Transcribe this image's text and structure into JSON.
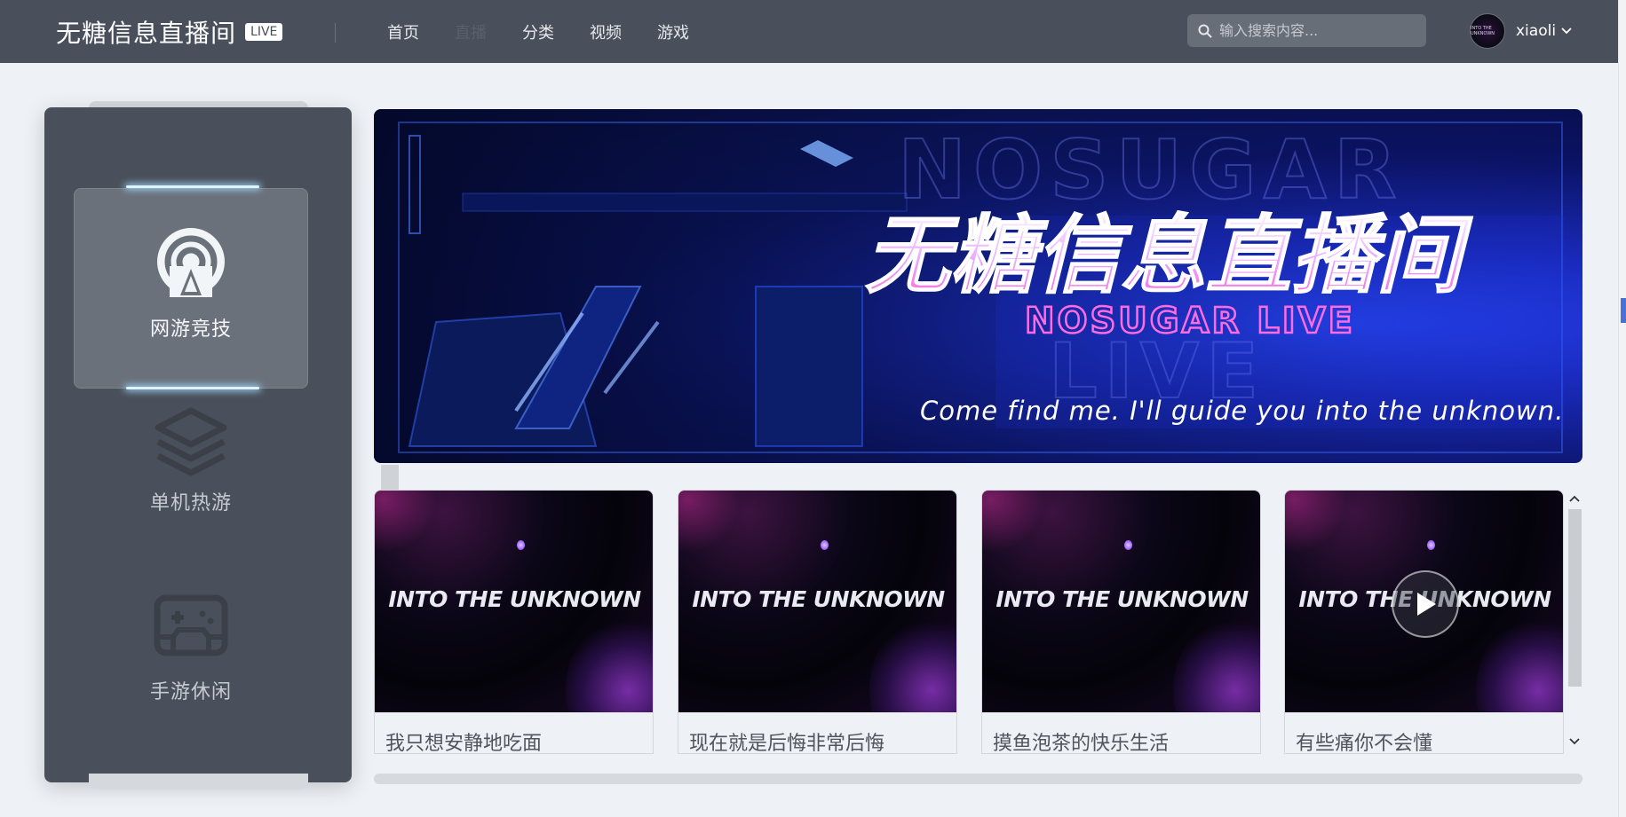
{
  "brand": {
    "title": "无糖信息直播间",
    "badge": "LIVE"
  },
  "nav": {
    "items": [
      {
        "label": "首页",
        "faint": false
      },
      {
        "label": "直播",
        "faint": true
      },
      {
        "label": "分类",
        "faint": false
      },
      {
        "label": "视频",
        "faint": false
      },
      {
        "label": "游戏",
        "faint": false
      }
    ]
  },
  "search": {
    "placeholder": "输入搜索内容..."
  },
  "user": {
    "name": "xiaoli",
    "avatar_text": "INTO THE UNKNOWN"
  },
  "categories": [
    {
      "label": "网游竞技",
      "icon": "broadcast-icon",
      "active": true
    },
    {
      "label": "单机热游",
      "icon": "layers-icon",
      "active": false
    },
    {
      "label": "手游休闲",
      "icon": "gamepad-icon",
      "active": false
    }
  ],
  "banner": {
    "outline_word": "NOSUGAR",
    "outline_word_2": "LIVE",
    "title": "无糖信息直播间",
    "subtitle": "NOSUGAR LIVE",
    "tagline": "Come find me. I'll guide you into the unknown."
  },
  "cards": [
    {
      "thumb_text": "INTO THE UNKNOWN",
      "title": "我只想安静地吃面",
      "playing": false
    },
    {
      "thumb_text": "INTO THE UNKNOWN",
      "title": "现在就是后悔非常后悔",
      "playing": false
    },
    {
      "thumb_text": "INTO THE UNKNOWN",
      "title": "摸鱼泡茶的快乐生活",
      "playing": false
    },
    {
      "thumb_text": "INTO THE UNKNOWN",
      "title": "有些痛你不会懂",
      "playing": true
    }
  ],
  "colors": {
    "topbar": "#4a505b",
    "panel": "#4a505b",
    "page_bg": "#eef1f5",
    "accent_glow": "#dff4ff"
  }
}
